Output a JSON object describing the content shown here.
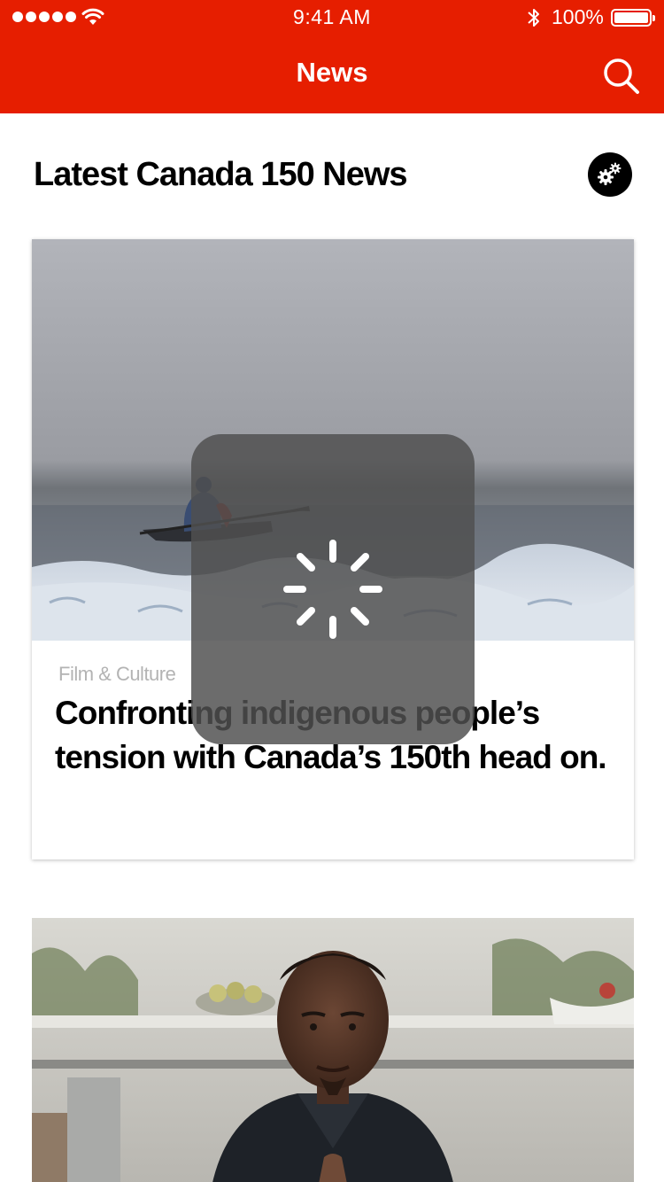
{
  "status_bar": {
    "time": "9:41 AM",
    "battery_percent": "100%",
    "signal_bars": 5
  },
  "nav": {
    "title": "News",
    "search_icon": "search-icon"
  },
  "section": {
    "title": "Latest Canada 150 News",
    "settings_icon": "gears-icon"
  },
  "articles": [
    {
      "image": "kayaker-on-icy-arctic-water",
      "category": "Film & Culture",
      "headline": "Confronting indigenous people’s tension with Canada’s 150th head on."
    },
    {
      "image": "chef-portrait-in-kitchen"
    }
  ],
  "loading": {
    "icon": "activity-spinner-icon"
  },
  "colors": {
    "brand": "#e61e00",
    "category": "#b3b3b3",
    "overlay": "#505050"
  }
}
